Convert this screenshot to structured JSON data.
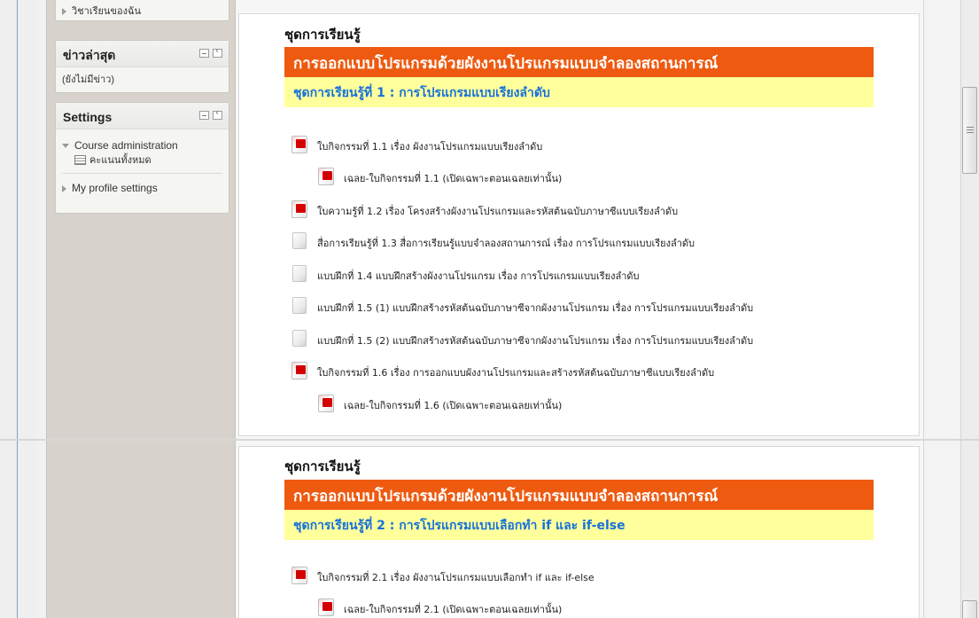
{
  "sidebar": {
    "my_courses": "วิชาเรียนของฉัน",
    "news_block": {
      "title": "ข่าวล่าสุด",
      "content": "(ยังไม่มีข่าว)"
    },
    "settings_block": {
      "title": "Settings",
      "course_admin": "Course administration",
      "grades": "คะแนนทั้งหมด",
      "my_profile": "My profile settings"
    }
  },
  "sections": [
    {
      "heading": "ชุดการเรียนรู้",
      "title": "การออกแบบโปรแกรมด้วยผังงานโปรแกรมแบบจำลองสถานการณ์",
      "subtitle": "ชุดการเรียนรู้ที่ 1 : การโปรแกรมแบบเรียงลำดับ",
      "items": [
        {
          "icon": "pdf-icon",
          "label": "ใบกิจกรรมที่ 1.1 เรื่อง ผังงานโปรแกรมแบบเรียงลำดับ"
        },
        {
          "icon": "pdf-icon",
          "label": "เฉลย-ใบกิจกรรมที่ 1.1 (เปิดเฉพาะตอนเฉลยเท่านั้น)"
        },
        {
          "icon": "pdf-icon",
          "label": "ใบความรู้ที่ 1.2 เรื่อง โครงสร้างผังงานโปรแกรมและรหัสต้นฉบับภาษาซีแบบเรียงลำดับ"
        },
        {
          "icon": "file-icon",
          "label": "สื่อการเรียนรู้ที่ 1.3 สื่อการเรียนรู้แบบจำลองสถานการณ์ เรื่อง การโปรแกรมแบบเรียงลำดับ"
        },
        {
          "icon": "file-icon",
          "label": "แบบฝึกที่ 1.4 แบบฝึกสร้างผังงานโปรแกรม เรื่อง การโปรแกรมแบบเรียงลำดับ"
        },
        {
          "icon": "file-icon",
          "label": "แบบฝึกที่ 1.5 (1) แบบฝึกสร้างรหัสต้นฉบับภาษาซีจากผังงานโปรแกรม เรื่อง การโปรแกรมแบบเรียงลำดับ"
        },
        {
          "icon": "file-icon",
          "label": "แบบฝึกที่ 1.5 (2) แบบฝึกสร้างรหัสต้นฉบับภาษาซีจากผังงานโปรแกรม เรื่อง การโปรแกรมแบบเรียงลำดับ"
        },
        {
          "icon": "pdf-icon",
          "label": "ใบกิจกรรมที่ 1.6 เรื่อง การออกแบบผังงานโปรแกรมและสร้างรหัสต้นฉบับภาษาซีแบบเรียงลำดับ"
        },
        {
          "icon": "pdf-icon",
          "label": "เฉลย-ใบกิจกรรมที่ 1.6 (เปิดเฉพาะตอนเฉลยเท่านั้น)"
        }
      ]
    },
    {
      "heading": "ชุดการเรียนรู้",
      "title": "การออกแบบโปรแกรมด้วยผังงานโปรแกรมแบบจำลองสถานการณ์",
      "subtitle": "ชุดการเรียนรู้ที่ 2 : การโปรแกรมแบบเลือกทำ if และ if-else",
      "items": [
        {
          "icon": "pdf-icon",
          "label": "ใบกิจกรรมที่ 2.1 เรื่อง ผังงานโปรแกรมแบบเลือกทำ if และ if-else"
        },
        {
          "icon": "pdf-icon",
          "label": "เฉลย-ใบกิจกรรมที่ 2.1 (เปิดเฉพาะตอนเฉลยเท่านั้น)"
        }
      ]
    }
  ]
}
